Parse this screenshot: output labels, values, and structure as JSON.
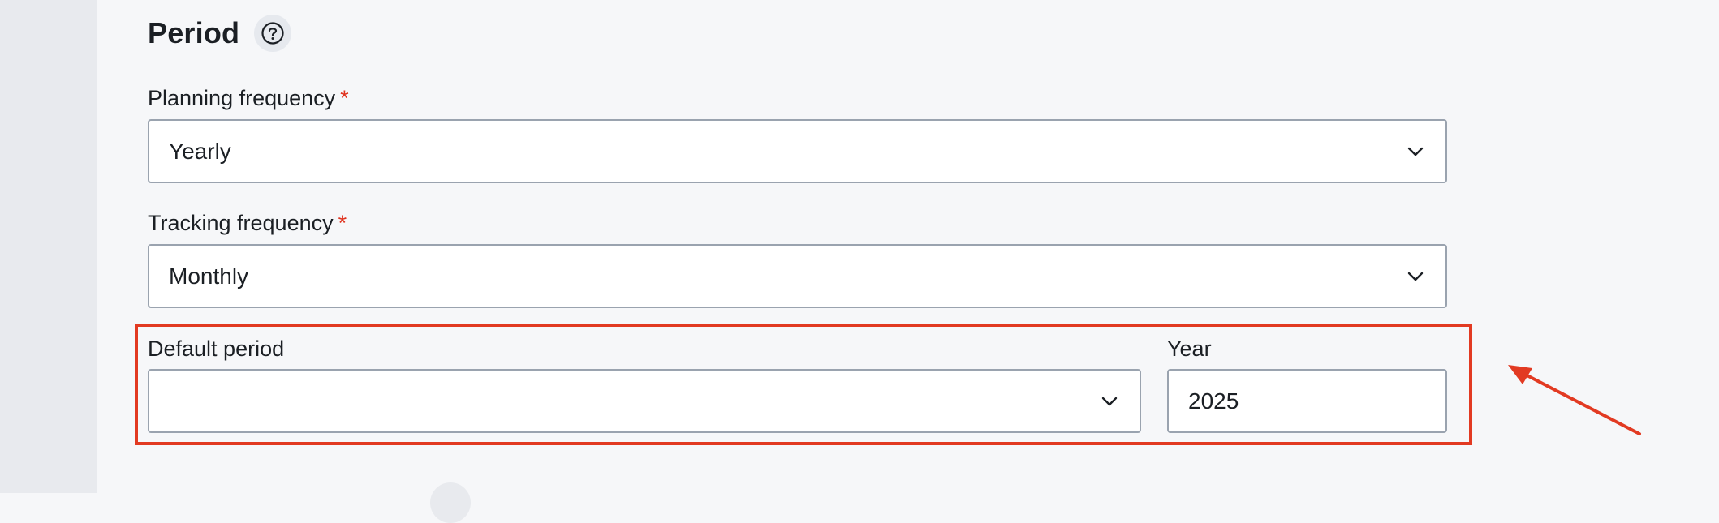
{
  "section": {
    "title": "Period"
  },
  "fields": {
    "planning_frequency": {
      "label": "Planning frequency",
      "required_mark": "*",
      "value": "Yearly"
    },
    "tracking_frequency": {
      "label": "Tracking frequency",
      "required_mark": "*",
      "value": "Monthly"
    },
    "default_period": {
      "label": "Default period",
      "value": ""
    },
    "year": {
      "label": "Year",
      "value": "2025"
    }
  },
  "annotation": {
    "color": "#e23a22"
  },
  "icons": {
    "help": "question-circle-icon",
    "chevron": "chevron-down-icon"
  }
}
